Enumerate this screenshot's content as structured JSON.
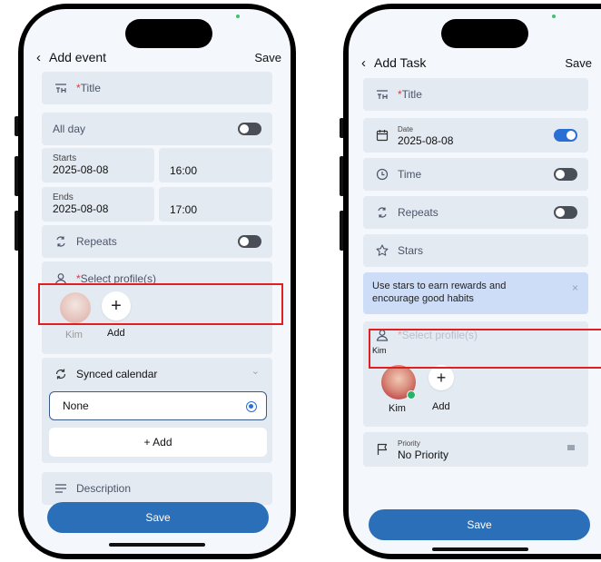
{
  "left": {
    "header": {
      "back": "‹",
      "title": "Add event",
      "save": "Save"
    },
    "title_field": {
      "required_mark": "*",
      "label": "Title"
    },
    "all_day": {
      "label": "All day",
      "on": false
    },
    "starts": {
      "label": "Starts",
      "date": "2025-08-08",
      "time": "16:00"
    },
    "ends": {
      "label": "Ends",
      "date": "2025-08-08",
      "time": "17:00"
    },
    "repeats": {
      "label": "Repeats",
      "on": false
    },
    "profiles": {
      "required_mark": "*",
      "label": "Select profile(s)",
      "avatar_name": "Kim",
      "add_label": "Add",
      "add_symbol": "+"
    },
    "synced_calendar": {
      "label": "Synced calendar",
      "option": "None",
      "add": "+ Add"
    },
    "description": {
      "label": "Description"
    },
    "save_button": "Save"
  },
  "right": {
    "header": {
      "back": "‹",
      "title": "Add Task",
      "save": "Save"
    },
    "title_field": {
      "required_mark": "*",
      "label": "Title"
    },
    "date": {
      "label": "Date",
      "value": "2025-08-08",
      "on": true
    },
    "time": {
      "label": "Time",
      "on": false
    },
    "repeats": {
      "label": "Repeats",
      "on": false
    },
    "stars": {
      "label": "Stars"
    },
    "tip": {
      "text": "Use stars to earn rewards and encourage good habits",
      "close": "×"
    },
    "profiles": {
      "required_mark": "*",
      "label": "Select profile(s)",
      "selected": "Kim",
      "avatar_name": "Kim",
      "add_label": "Add",
      "add_symbol": "+"
    },
    "priority": {
      "label": "Priority",
      "value": "No Priority"
    },
    "save_button": "Save"
  },
  "colors": {
    "accent": "#2a6fb8",
    "toggle_on": "#2a6fd4",
    "highlight": "#e02020",
    "tip_bg": "#cdddf7"
  }
}
